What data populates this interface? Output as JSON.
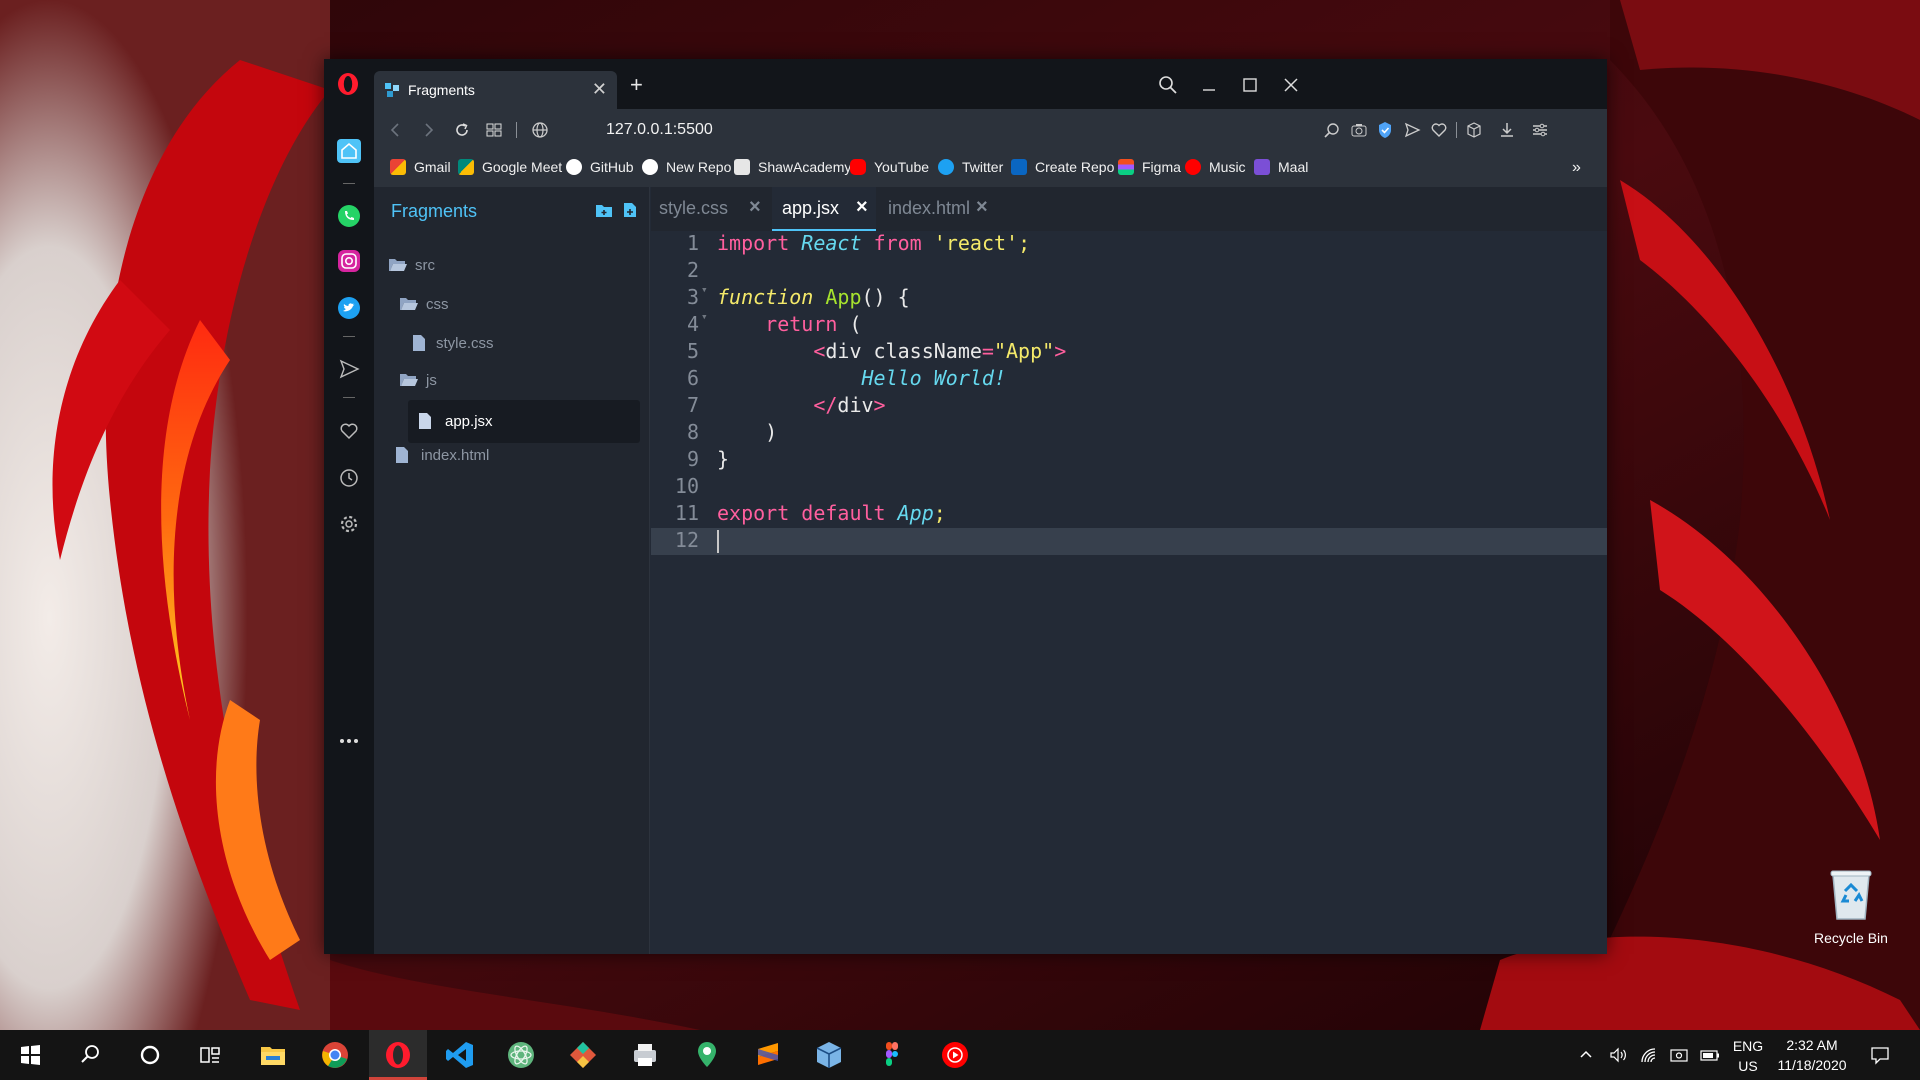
{
  "browser": {
    "tab_title": "Fragments",
    "url": "127.0.0.1:5500",
    "bookmarks": [
      {
        "label": "Gmail",
        "icon": "gmail-icon",
        "color": "#ea4335"
      },
      {
        "label": "Google Meet",
        "icon": "google-meet-icon",
        "color": "#00897b"
      },
      {
        "label": "GitHub",
        "icon": "github-icon",
        "color": "#ffffff"
      },
      {
        "label": "New Repo",
        "icon": "github-icon",
        "color": "#ffffff"
      },
      {
        "label": "ShawAcademy",
        "icon": "shaw-academy-icon",
        "color": "#ffffff"
      },
      {
        "label": "YouTube",
        "icon": "youtube-icon",
        "color": "#ff0000"
      },
      {
        "label": "Twitter",
        "icon": "twitter-icon",
        "color": "#1da1f2"
      },
      {
        "label": "Create Repo",
        "icon": "linkedin-icon",
        "color": "#0a66c2"
      },
      {
        "label": "Figma",
        "icon": "figma-icon",
        "color": "#f24e1e"
      },
      {
        "label": "Music",
        "icon": "music-icon",
        "color": "#ff0000"
      },
      {
        "label": "Maal",
        "icon": "maal-icon",
        "color": "#7b4fd6"
      }
    ]
  },
  "app": {
    "panel_title": "Fragments",
    "tree": [
      {
        "label": "src",
        "type": "folder"
      },
      {
        "label": "css",
        "type": "folder"
      },
      {
        "label": "style.css",
        "type": "file"
      },
      {
        "label": "js",
        "type": "folder"
      },
      {
        "label": "app.jsx",
        "type": "file",
        "selected": true
      },
      {
        "label": "index.html",
        "type": "file"
      }
    ],
    "tabs": [
      {
        "label": "style.css",
        "active": false
      },
      {
        "label": "app.jsx",
        "active": true
      },
      {
        "label": "index.html",
        "active": false
      }
    ],
    "code_lines": [
      {
        "n": "1"
      },
      {
        "n": "2"
      },
      {
        "n": "3"
      },
      {
        "n": "4"
      },
      {
        "n": "5"
      },
      {
        "n": "6"
      },
      {
        "n": "7"
      },
      {
        "n": "8"
      },
      {
        "n": "9"
      },
      {
        "n": "10"
      },
      {
        "n": "11"
      },
      {
        "n": "12"
      }
    ],
    "code": {
      "l1_import": "import",
      "l1_react": "React",
      "l1_from": "from",
      "l1_str": "'react'",
      "l1_semi": ";",
      "l3_function": "function",
      "l3_name": "App",
      "l3_rest": "() {",
      "l4_return": "return",
      "l4_rest": " (",
      "l5_open": "<",
      "l5_tag": "div",
      "l5_attr": " className",
      "l5_eq": "=",
      "l5_val": "\"App\"",
      "l5_close": ">",
      "l6_text": "Hello World!",
      "l7_open": "</",
      "l7_tag": "div",
      "l7_close": ">",
      "l8_paren": ")",
      "l9_brace": "}",
      "l11_export": "export",
      "l11_default": "default",
      "l11_app": "App",
      "l11_semi": ";"
    }
  },
  "desktop": {
    "recycle_bin": "Recycle Bin"
  },
  "taskbar": {
    "lang_top": "ENG",
    "lang_bottom": "US",
    "time": "2:32 AM",
    "date": "11/18/2020"
  },
  "colors": {
    "accent": "#4fc3f7",
    "opera_red": "#ff1b2d",
    "keyword": "#ff5f9e",
    "string": "#f4e96a",
    "function_name": "#a6e22e",
    "italic_identifier": "#66d9ef"
  }
}
